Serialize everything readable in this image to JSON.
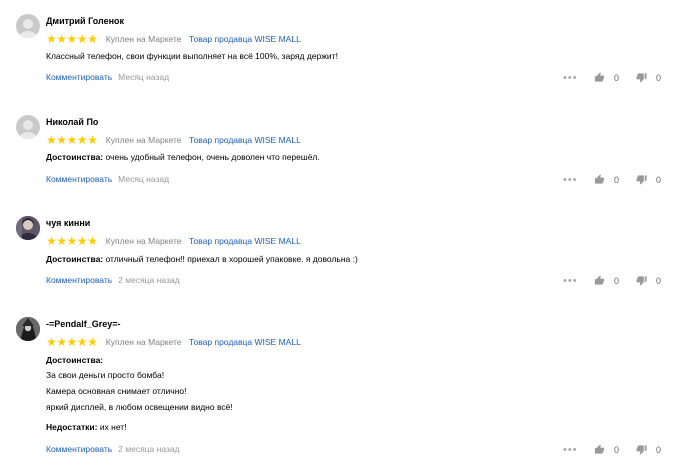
{
  "reviews": [
    {
      "author": "Дмитрий Голенок",
      "avatar": "default-avatar",
      "rating": 5,
      "bought": "Куплен на Маркете",
      "seller": "Товар продавца WISE MALL",
      "text": "Классный телефон, свои функции выполняет на всё 100%, заряд держит!",
      "comment_label": "Комментировать",
      "date": "Месяц назад",
      "likes": "0",
      "dislikes": "0"
    },
    {
      "author": "Николай По",
      "avatar": "default-avatar",
      "rating": 5,
      "bought": "Куплен на Маркете",
      "seller": "Товар продавца WISE MALL",
      "pros_label": "Достоинства:",
      "pros": "очень удобный телефон, очень доволен что перешёл.",
      "comment_label": "Комментировать",
      "date": "Месяц назад",
      "likes": "0",
      "dislikes": "0"
    },
    {
      "author": "чуя кинни",
      "avatar": "photo-avatar",
      "rating": 5,
      "bought": "Куплен на Маркете",
      "seller": "Товар продавца WISE MALL",
      "pros_label": "Достоинства:",
      "pros": "отличный телефон!! приехал в хорошей упаковке. я довольна :)",
      "comment_label": "Комментировать",
      "date": "2 месяца назад",
      "likes": "0",
      "dislikes": "0"
    },
    {
      "author": "-=Pendalf_Grey=-",
      "avatar": "photo-avatar",
      "rating": 5,
      "bought": "Куплен на Маркете",
      "seller": "Товар продавца WISE MALL",
      "pros_label": "Достоинства:",
      "pros_lines": [
        "За свои деньги просто бомба!",
        "Камера основная снимает отлично!",
        "яркий дисплей, в любом освещении видно всё!"
      ],
      "cons_label": "Недостатки:",
      "cons": "их нет!",
      "comment_label": "Комментировать",
      "date": "2 месяца назад",
      "likes": "0",
      "dislikes": "0"
    }
  ],
  "colors": {
    "star": "#ffcc00",
    "link": "#1e5fbf",
    "muted": "#999999"
  },
  "icons": {
    "more": "more-dots-icon",
    "like": "thumb-up-icon",
    "dislike": "thumb-down-icon",
    "star": "star-icon"
  }
}
